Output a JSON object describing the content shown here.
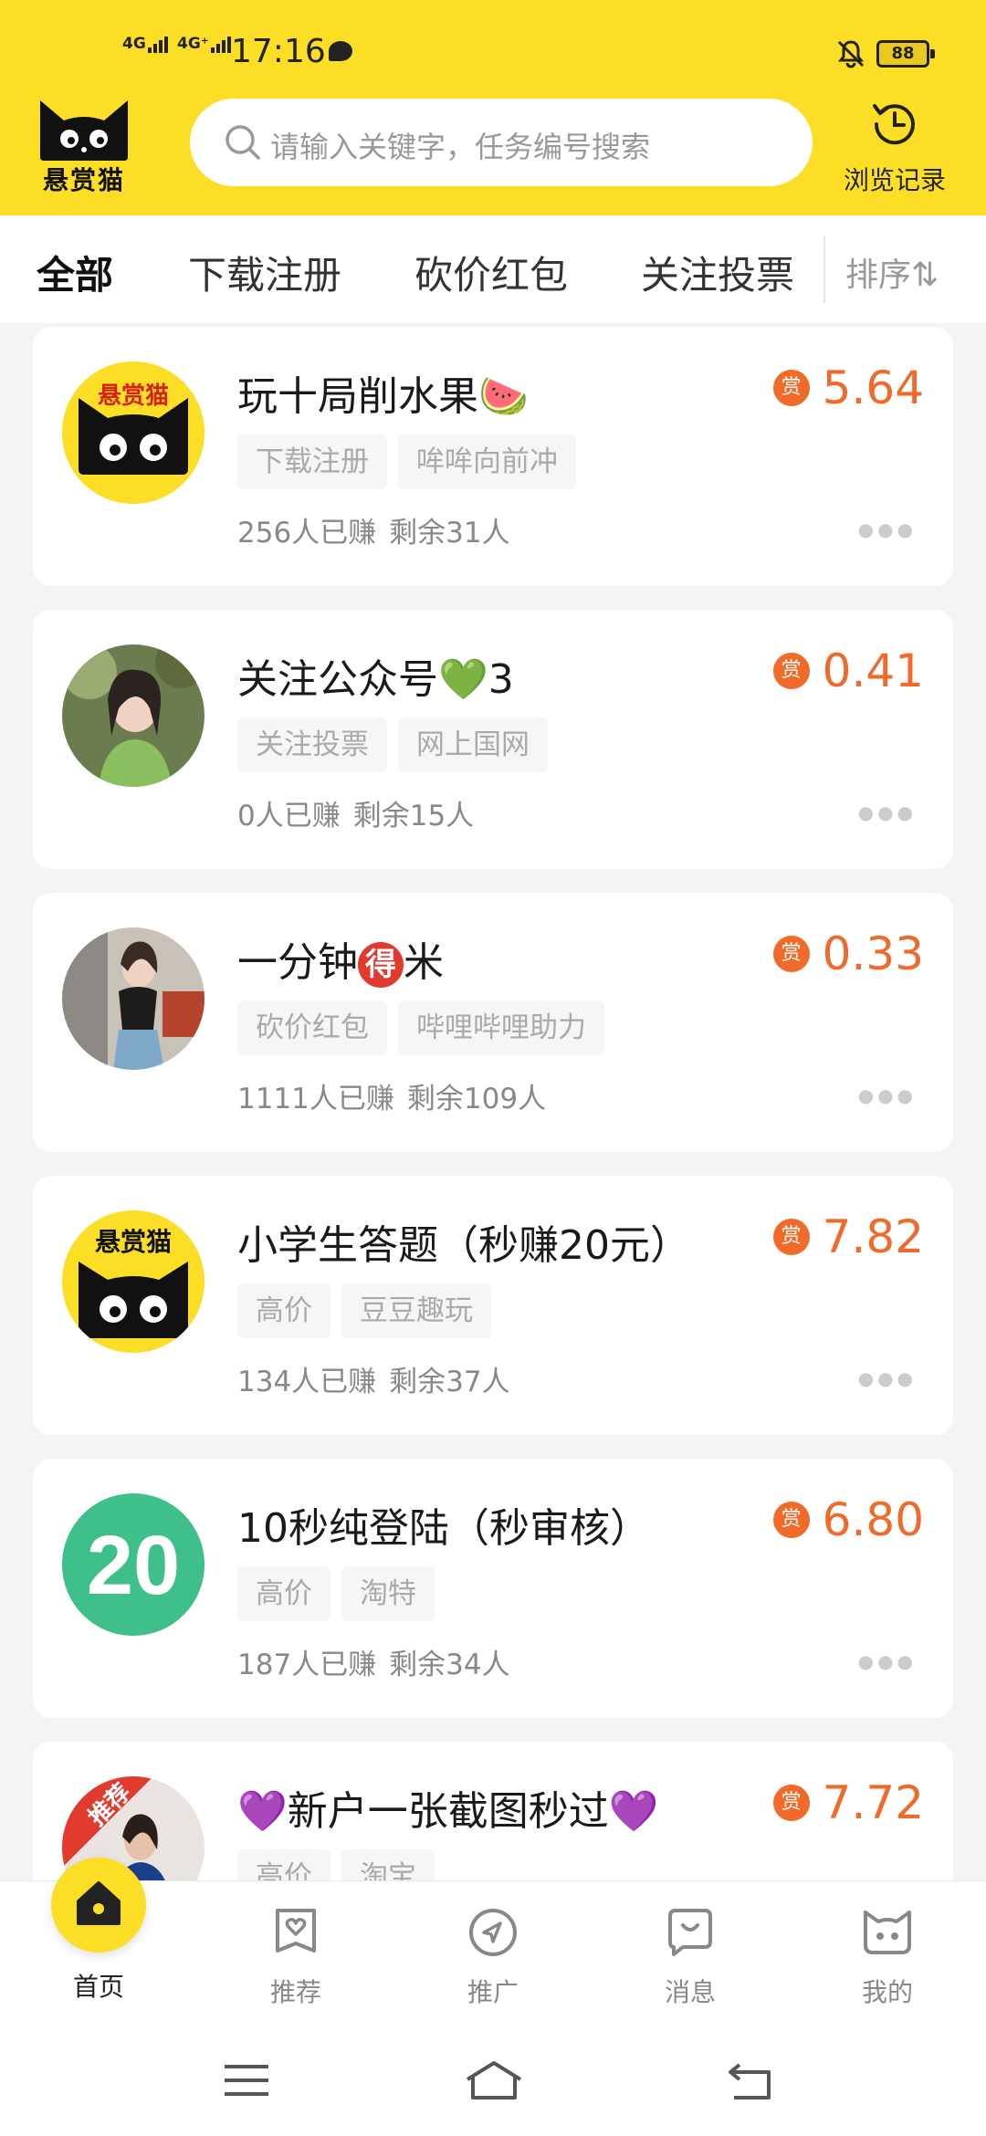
{
  "status_bar": {
    "network1": "4G",
    "network2": "4G⁺",
    "time": "17:16",
    "battery": "88"
  },
  "header": {
    "logo_text": "悬赏猫",
    "search_placeholder": "请输入关键字，任务编号搜索",
    "history_label": "浏览记录"
  },
  "tabs": {
    "items": [
      {
        "label": "全部",
        "active": true
      },
      {
        "label": "下载注册",
        "active": false
      },
      {
        "label": "砍价红包",
        "active": false
      },
      {
        "label": "关注投票",
        "active": false
      }
    ],
    "sort_label": "排序⇅"
  },
  "tasks": [
    {
      "title": "玩十局削水果🍉",
      "tags": [
        "下载注册",
        "哞哞向前冲"
      ],
      "earned": "256人已赚",
      "remaining": "剩余31人",
      "reward_badge": "赏",
      "reward": "5.64",
      "avatar": "logo-cat-icon",
      "avatar_text": "悬赏猫"
    },
    {
      "title_main": "关注公众号",
      "title_emoji": "💚",
      "title_suffix": "3",
      "tags": [
        "关注投票",
        "网上国网"
      ],
      "earned": "0人已赚",
      "remaining": "剩余15人",
      "reward_badge": "赏",
      "reward": "0.41",
      "avatar": "photo-woman-avatar"
    },
    {
      "title_main": "一分钟",
      "title_badge": "得",
      "title_suffix": "米",
      "tags": [
        "砍价红包",
        "哔哩哔哩助力"
      ],
      "earned": "1111人已赚",
      "remaining": "剩余109人",
      "reward_badge": "赏",
      "reward": "0.33",
      "avatar": "photo-woman-avatar"
    },
    {
      "title": "小学生答题（秒赚20元）",
      "tags": [
        "高价",
        "豆豆趣玩"
      ],
      "earned": "134人已赚",
      "remaining": "剩余37人",
      "reward_badge": "赏",
      "reward": "7.82",
      "avatar": "logo-cat-icon",
      "avatar_text": "悬赏猫"
    },
    {
      "title": "10秒纯登陆（秒审核）",
      "tags": [
        "高价",
        "淘特"
      ],
      "earned": "187人已赚",
      "remaining": "剩余34人",
      "reward_badge": "赏",
      "reward": "6.80",
      "avatar": "number-20-icon",
      "avatar_text": "20"
    },
    {
      "title_prefix": "💜",
      "title_main": "新户一张截图秒过",
      "title_suffix": "💜",
      "tags": [
        "高价",
        "淘宝"
      ],
      "reward_badge": "赏",
      "reward": "7.72",
      "avatar": "photo-recommend-avatar",
      "avatar_text": "推荐"
    }
  ],
  "bottom_nav": [
    {
      "label": "首页",
      "icon": "home-icon",
      "active": true
    },
    {
      "label": "推荐",
      "icon": "recommend-heart-icon",
      "active": false
    },
    {
      "label": "推广",
      "icon": "promote-compass-icon",
      "active": false
    },
    {
      "label": "消息",
      "icon": "message-icon",
      "active": false
    },
    {
      "label": "我的",
      "icon": "cat-face-icon",
      "active": false
    }
  ],
  "colors": {
    "brand_yellow": "#fcde26",
    "reward_orange": "#f26a2a"
  }
}
